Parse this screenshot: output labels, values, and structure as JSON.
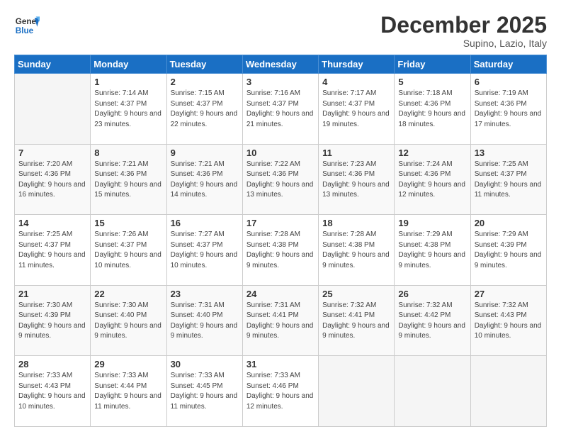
{
  "header": {
    "logo_general": "General",
    "logo_blue": "Blue",
    "month_title": "December 2025",
    "location": "Supino, Lazio, Italy"
  },
  "days_of_week": [
    "Sunday",
    "Monday",
    "Tuesday",
    "Wednesday",
    "Thursday",
    "Friday",
    "Saturday"
  ],
  "weeks": [
    [
      {
        "day": "",
        "sunrise": "",
        "sunset": "",
        "daylight": ""
      },
      {
        "day": "1",
        "sunrise": "Sunrise: 7:14 AM",
        "sunset": "Sunset: 4:37 PM",
        "daylight": "Daylight: 9 hours and 23 minutes."
      },
      {
        "day": "2",
        "sunrise": "Sunrise: 7:15 AM",
        "sunset": "Sunset: 4:37 PM",
        "daylight": "Daylight: 9 hours and 22 minutes."
      },
      {
        "day": "3",
        "sunrise": "Sunrise: 7:16 AM",
        "sunset": "Sunset: 4:37 PM",
        "daylight": "Daylight: 9 hours and 21 minutes."
      },
      {
        "day": "4",
        "sunrise": "Sunrise: 7:17 AM",
        "sunset": "Sunset: 4:37 PM",
        "daylight": "Daylight: 9 hours and 19 minutes."
      },
      {
        "day": "5",
        "sunrise": "Sunrise: 7:18 AM",
        "sunset": "Sunset: 4:36 PM",
        "daylight": "Daylight: 9 hours and 18 minutes."
      },
      {
        "day": "6",
        "sunrise": "Sunrise: 7:19 AM",
        "sunset": "Sunset: 4:36 PM",
        "daylight": "Daylight: 9 hours and 17 minutes."
      }
    ],
    [
      {
        "day": "7",
        "sunrise": "Sunrise: 7:20 AM",
        "sunset": "Sunset: 4:36 PM",
        "daylight": "Daylight: 9 hours and 16 minutes."
      },
      {
        "day": "8",
        "sunrise": "Sunrise: 7:21 AM",
        "sunset": "Sunset: 4:36 PM",
        "daylight": "Daylight: 9 hours and 15 minutes."
      },
      {
        "day": "9",
        "sunrise": "Sunrise: 7:21 AM",
        "sunset": "Sunset: 4:36 PM",
        "daylight": "Daylight: 9 hours and 14 minutes."
      },
      {
        "day": "10",
        "sunrise": "Sunrise: 7:22 AM",
        "sunset": "Sunset: 4:36 PM",
        "daylight": "Daylight: 9 hours and 13 minutes."
      },
      {
        "day": "11",
        "sunrise": "Sunrise: 7:23 AM",
        "sunset": "Sunset: 4:36 PM",
        "daylight": "Daylight: 9 hours and 13 minutes."
      },
      {
        "day": "12",
        "sunrise": "Sunrise: 7:24 AM",
        "sunset": "Sunset: 4:36 PM",
        "daylight": "Daylight: 9 hours and 12 minutes."
      },
      {
        "day": "13",
        "sunrise": "Sunrise: 7:25 AM",
        "sunset": "Sunset: 4:37 PM",
        "daylight": "Daylight: 9 hours and 11 minutes."
      }
    ],
    [
      {
        "day": "14",
        "sunrise": "Sunrise: 7:25 AM",
        "sunset": "Sunset: 4:37 PM",
        "daylight": "Daylight: 9 hours and 11 minutes."
      },
      {
        "day": "15",
        "sunrise": "Sunrise: 7:26 AM",
        "sunset": "Sunset: 4:37 PM",
        "daylight": "Daylight: 9 hours and 10 minutes."
      },
      {
        "day": "16",
        "sunrise": "Sunrise: 7:27 AM",
        "sunset": "Sunset: 4:37 PM",
        "daylight": "Daylight: 9 hours and 10 minutes."
      },
      {
        "day": "17",
        "sunrise": "Sunrise: 7:28 AM",
        "sunset": "Sunset: 4:38 PM",
        "daylight": "Daylight: 9 hours and 9 minutes."
      },
      {
        "day": "18",
        "sunrise": "Sunrise: 7:28 AM",
        "sunset": "Sunset: 4:38 PM",
        "daylight": "Daylight: 9 hours and 9 minutes."
      },
      {
        "day": "19",
        "sunrise": "Sunrise: 7:29 AM",
        "sunset": "Sunset: 4:38 PM",
        "daylight": "Daylight: 9 hours and 9 minutes."
      },
      {
        "day": "20",
        "sunrise": "Sunrise: 7:29 AM",
        "sunset": "Sunset: 4:39 PM",
        "daylight": "Daylight: 9 hours and 9 minutes."
      }
    ],
    [
      {
        "day": "21",
        "sunrise": "Sunrise: 7:30 AM",
        "sunset": "Sunset: 4:39 PM",
        "daylight": "Daylight: 9 hours and 9 minutes."
      },
      {
        "day": "22",
        "sunrise": "Sunrise: 7:30 AM",
        "sunset": "Sunset: 4:40 PM",
        "daylight": "Daylight: 9 hours and 9 minutes."
      },
      {
        "day": "23",
        "sunrise": "Sunrise: 7:31 AM",
        "sunset": "Sunset: 4:40 PM",
        "daylight": "Daylight: 9 hours and 9 minutes."
      },
      {
        "day": "24",
        "sunrise": "Sunrise: 7:31 AM",
        "sunset": "Sunset: 4:41 PM",
        "daylight": "Daylight: 9 hours and 9 minutes."
      },
      {
        "day": "25",
        "sunrise": "Sunrise: 7:32 AM",
        "sunset": "Sunset: 4:41 PM",
        "daylight": "Daylight: 9 hours and 9 minutes."
      },
      {
        "day": "26",
        "sunrise": "Sunrise: 7:32 AM",
        "sunset": "Sunset: 4:42 PM",
        "daylight": "Daylight: 9 hours and 9 minutes."
      },
      {
        "day": "27",
        "sunrise": "Sunrise: 7:32 AM",
        "sunset": "Sunset: 4:43 PM",
        "daylight": "Daylight: 9 hours and 10 minutes."
      }
    ],
    [
      {
        "day": "28",
        "sunrise": "Sunrise: 7:33 AM",
        "sunset": "Sunset: 4:43 PM",
        "daylight": "Daylight: 9 hours and 10 minutes."
      },
      {
        "day": "29",
        "sunrise": "Sunrise: 7:33 AM",
        "sunset": "Sunset: 4:44 PM",
        "daylight": "Daylight: 9 hours and 11 minutes."
      },
      {
        "day": "30",
        "sunrise": "Sunrise: 7:33 AM",
        "sunset": "Sunset: 4:45 PM",
        "daylight": "Daylight: 9 hours and 11 minutes."
      },
      {
        "day": "31",
        "sunrise": "Sunrise: 7:33 AM",
        "sunset": "Sunset: 4:46 PM",
        "daylight": "Daylight: 9 hours and 12 minutes."
      },
      {
        "day": "",
        "sunrise": "",
        "sunset": "",
        "daylight": ""
      },
      {
        "day": "",
        "sunrise": "",
        "sunset": "",
        "daylight": ""
      },
      {
        "day": "",
        "sunrise": "",
        "sunset": "",
        "daylight": ""
      }
    ]
  ]
}
